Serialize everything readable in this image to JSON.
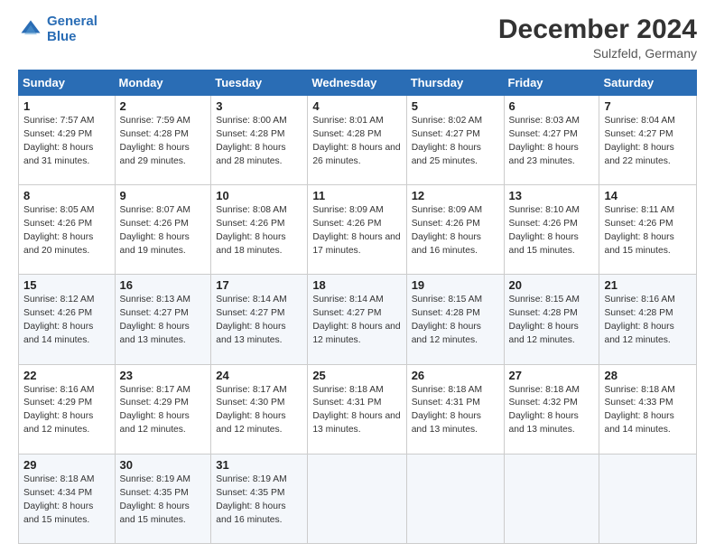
{
  "header": {
    "logo_line1": "General",
    "logo_line2": "Blue",
    "month_title": "December 2024",
    "location": "Sulzfeld, Germany"
  },
  "days_of_week": [
    "Sunday",
    "Monday",
    "Tuesday",
    "Wednesday",
    "Thursday",
    "Friday",
    "Saturday"
  ],
  "weeks": [
    [
      {
        "day": "1",
        "sunrise": "Sunrise: 7:57 AM",
        "sunset": "Sunset: 4:29 PM",
        "daylight": "Daylight: 8 hours and 31 minutes."
      },
      {
        "day": "2",
        "sunrise": "Sunrise: 7:59 AM",
        "sunset": "Sunset: 4:28 PM",
        "daylight": "Daylight: 8 hours and 29 minutes."
      },
      {
        "day": "3",
        "sunrise": "Sunrise: 8:00 AM",
        "sunset": "Sunset: 4:28 PM",
        "daylight": "Daylight: 8 hours and 28 minutes."
      },
      {
        "day": "4",
        "sunrise": "Sunrise: 8:01 AM",
        "sunset": "Sunset: 4:28 PM",
        "daylight": "Daylight: 8 hours and 26 minutes."
      },
      {
        "day": "5",
        "sunrise": "Sunrise: 8:02 AM",
        "sunset": "Sunset: 4:27 PM",
        "daylight": "Daylight: 8 hours and 25 minutes."
      },
      {
        "day": "6",
        "sunrise": "Sunrise: 8:03 AM",
        "sunset": "Sunset: 4:27 PM",
        "daylight": "Daylight: 8 hours and 23 minutes."
      },
      {
        "day": "7",
        "sunrise": "Sunrise: 8:04 AM",
        "sunset": "Sunset: 4:27 PM",
        "daylight": "Daylight: 8 hours and 22 minutes."
      }
    ],
    [
      {
        "day": "8",
        "sunrise": "Sunrise: 8:05 AM",
        "sunset": "Sunset: 4:26 PM",
        "daylight": "Daylight: 8 hours and 20 minutes."
      },
      {
        "day": "9",
        "sunrise": "Sunrise: 8:07 AM",
        "sunset": "Sunset: 4:26 PM",
        "daylight": "Daylight: 8 hours and 19 minutes."
      },
      {
        "day": "10",
        "sunrise": "Sunrise: 8:08 AM",
        "sunset": "Sunset: 4:26 PM",
        "daylight": "Daylight: 8 hours and 18 minutes."
      },
      {
        "day": "11",
        "sunrise": "Sunrise: 8:09 AM",
        "sunset": "Sunset: 4:26 PM",
        "daylight": "Daylight: 8 hours and 17 minutes."
      },
      {
        "day": "12",
        "sunrise": "Sunrise: 8:09 AM",
        "sunset": "Sunset: 4:26 PM",
        "daylight": "Daylight: 8 hours and 16 minutes."
      },
      {
        "day": "13",
        "sunrise": "Sunrise: 8:10 AM",
        "sunset": "Sunset: 4:26 PM",
        "daylight": "Daylight: 8 hours and 15 minutes."
      },
      {
        "day": "14",
        "sunrise": "Sunrise: 8:11 AM",
        "sunset": "Sunset: 4:26 PM",
        "daylight": "Daylight: 8 hours and 15 minutes."
      }
    ],
    [
      {
        "day": "15",
        "sunrise": "Sunrise: 8:12 AM",
        "sunset": "Sunset: 4:26 PM",
        "daylight": "Daylight: 8 hours and 14 minutes."
      },
      {
        "day": "16",
        "sunrise": "Sunrise: 8:13 AM",
        "sunset": "Sunset: 4:27 PM",
        "daylight": "Daylight: 8 hours and 13 minutes."
      },
      {
        "day": "17",
        "sunrise": "Sunrise: 8:14 AM",
        "sunset": "Sunset: 4:27 PM",
        "daylight": "Daylight: 8 hours and 13 minutes."
      },
      {
        "day": "18",
        "sunrise": "Sunrise: 8:14 AM",
        "sunset": "Sunset: 4:27 PM",
        "daylight": "Daylight: 8 hours and 12 minutes."
      },
      {
        "day": "19",
        "sunrise": "Sunrise: 8:15 AM",
        "sunset": "Sunset: 4:28 PM",
        "daylight": "Daylight: 8 hours and 12 minutes."
      },
      {
        "day": "20",
        "sunrise": "Sunrise: 8:15 AM",
        "sunset": "Sunset: 4:28 PM",
        "daylight": "Daylight: 8 hours and 12 minutes."
      },
      {
        "day": "21",
        "sunrise": "Sunrise: 8:16 AM",
        "sunset": "Sunset: 4:28 PM",
        "daylight": "Daylight: 8 hours and 12 minutes."
      }
    ],
    [
      {
        "day": "22",
        "sunrise": "Sunrise: 8:16 AM",
        "sunset": "Sunset: 4:29 PM",
        "daylight": "Daylight: 8 hours and 12 minutes."
      },
      {
        "day": "23",
        "sunrise": "Sunrise: 8:17 AM",
        "sunset": "Sunset: 4:29 PM",
        "daylight": "Daylight: 8 hours and 12 minutes."
      },
      {
        "day": "24",
        "sunrise": "Sunrise: 8:17 AM",
        "sunset": "Sunset: 4:30 PM",
        "daylight": "Daylight: 8 hours and 12 minutes."
      },
      {
        "day": "25",
        "sunrise": "Sunrise: 8:18 AM",
        "sunset": "Sunset: 4:31 PM",
        "daylight": "Daylight: 8 hours and 13 minutes."
      },
      {
        "day": "26",
        "sunrise": "Sunrise: 8:18 AM",
        "sunset": "Sunset: 4:31 PM",
        "daylight": "Daylight: 8 hours and 13 minutes."
      },
      {
        "day": "27",
        "sunrise": "Sunrise: 8:18 AM",
        "sunset": "Sunset: 4:32 PM",
        "daylight": "Daylight: 8 hours and 13 minutes."
      },
      {
        "day": "28",
        "sunrise": "Sunrise: 8:18 AM",
        "sunset": "Sunset: 4:33 PM",
        "daylight": "Daylight: 8 hours and 14 minutes."
      }
    ],
    [
      {
        "day": "29",
        "sunrise": "Sunrise: 8:18 AM",
        "sunset": "Sunset: 4:34 PM",
        "daylight": "Daylight: 8 hours and 15 minutes."
      },
      {
        "day": "30",
        "sunrise": "Sunrise: 8:19 AM",
        "sunset": "Sunset: 4:35 PM",
        "daylight": "Daylight: 8 hours and 15 minutes."
      },
      {
        "day": "31",
        "sunrise": "Sunrise: 8:19 AM",
        "sunset": "Sunset: 4:35 PM",
        "daylight": "Daylight: 8 hours and 16 minutes."
      },
      null,
      null,
      null,
      null
    ]
  ]
}
